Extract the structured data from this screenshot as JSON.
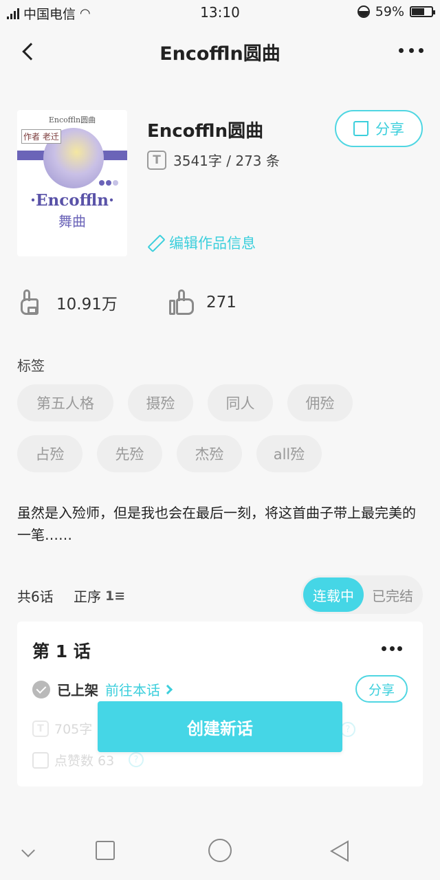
{
  "status_bar": {
    "network": "4G",
    "carrier": "中国电信",
    "time": "13:10",
    "battery": "59%"
  },
  "header": {
    "title": "Encoffln圆曲"
  },
  "work": {
    "title": "Encoffln圆曲",
    "share_label": "分享",
    "words": "3541字 / 273 条",
    "edit_label": "编辑作品信息"
  },
  "cover": {
    "top_text": "Encoffln圆曲",
    "author": "作者 老迁",
    "title": "·Encoffln·",
    "subtitle": "舞曲"
  },
  "reactions": {
    "views": "10.91万",
    "likes": "271"
  },
  "tags": {
    "label": "标签",
    "items": [
      "第五人格",
      "摄殓",
      "同人",
      "佣殓",
      "占殓",
      "先殓",
      "杰殓",
      "all殓"
    ]
  },
  "description": "虽然是入殓师，但是我也会在最后一刻，将这首曲子带上最完美的一笔……",
  "chapters": {
    "count_label": "共6话",
    "sort_label": "正序",
    "status_on": "连载中",
    "status_off": "已完结",
    "first": {
      "title": "第 1 话",
      "status": "已上架",
      "goto": "前往本话",
      "share": "分享",
      "words": "705字",
      "likes": "点赞数 63"
    }
  },
  "create_button": "创建新话",
  "colors": {
    "accent": "#45d6e6",
    "tag_bg": "#eeeeee",
    "background": "#f7f7f7"
  }
}
